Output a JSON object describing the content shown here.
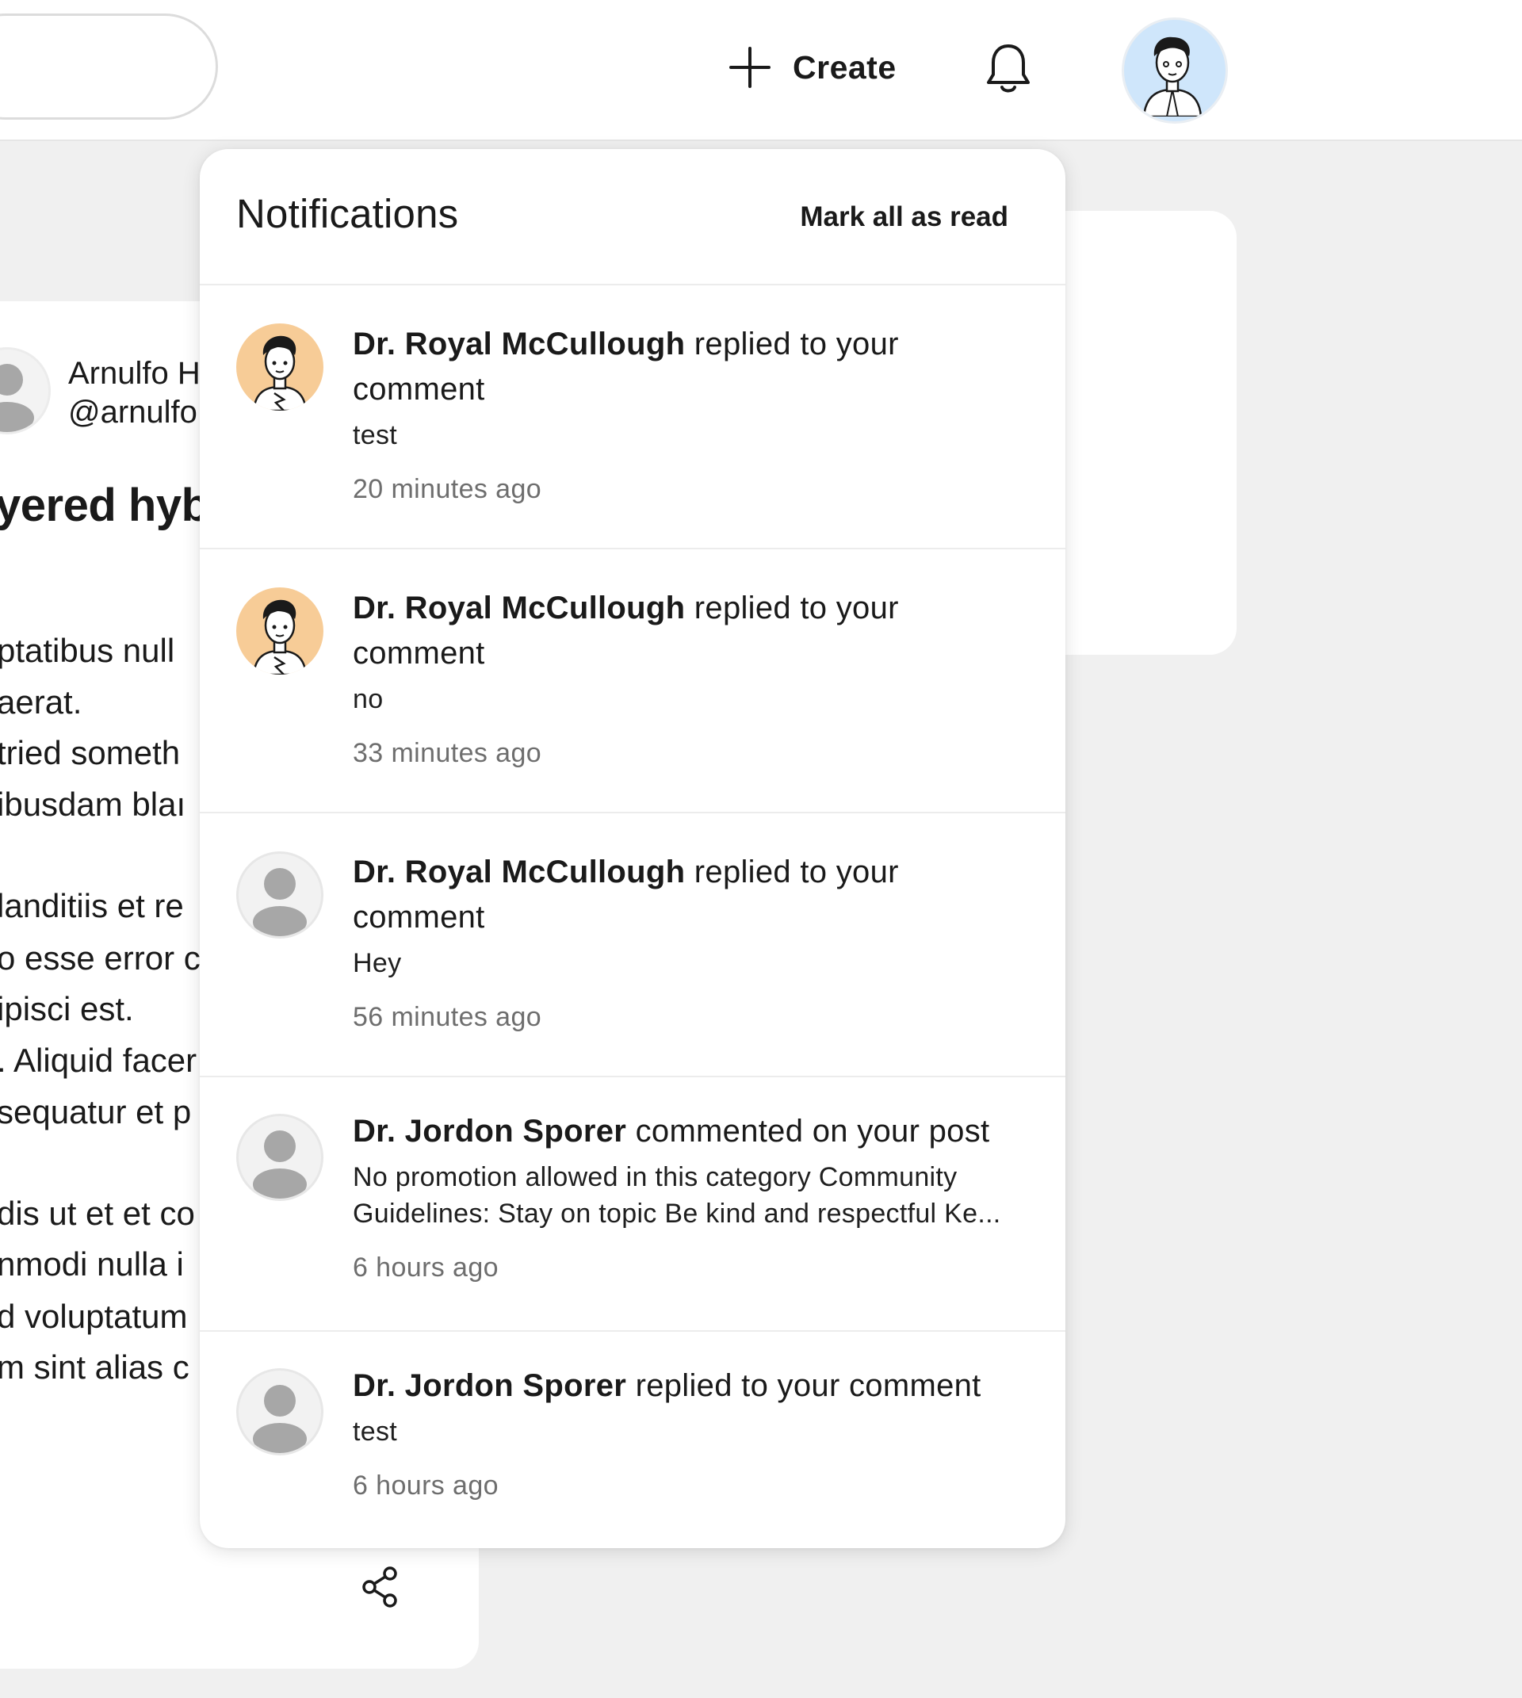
{
  "header": {
    "create_label": "Create",
    "icons": {
      "create": "plus-icon",
      "notifications": "bell-icon",
      "profile": "user-avatar"
    }
  },
  "background_post": {
    "author": "Arnulfo H",
    "handle": "@arnulfo",
    "title": "yered hyb",
    "lines": [
      "ptatibus null",
      "aerat.",
      "tried someth",
      "ibusdam blaı",
      "landitiis et re",
      "o esse error c",
      "ipisci est.",
      ". Aliquid facer",
      "sequatur et p",
      "dis ut et et co",
      "nmodi nulla i",
      "d voluptatum",
      "m sint alias c"
    ]
  },
  "notifications": {
    "title": "Notifications",
    "mark_all_label": "Mark all as read",
    "items": [
      {
        "actor": "Dr. Royal McCullough",
        "action": "replied to your comment",
        "preview": "test",
        "time": "20 minutes ago",
        "avatar": "illustrated-orange"
      },
      {
        "actor": "Dr. Royal McCullough",
        "action": "replied to your comment",
        "preview": "no",
        "time": "33 minutes ago",
        "avatar": "illustrated-orange"
      },
      {
        "actor": "Dr. Royal McCullough",
        "action": "replied to your comment",
        "preview": "Hey",
        "time": "56 minutes ago",
        "avatar": "default-gray"
      },
      {
        "actor": "Dr. Jordon Sporer",
        "action": "commented on your post",
        "preview": "No promotion allowed in this category Community Guidelines: Stay on topic Be kind and respectful Ke...",
        "time": "6 hours ago",
        "avatar": "default-gray"
      },
      {
        "actor": "Dr. Jordon Sporer",
        "action": "replied to your comment",
        "preview": "test",
        "time": "6 hours ago",
        "avatar": "default-gray"
      }
    ]
  }
}
